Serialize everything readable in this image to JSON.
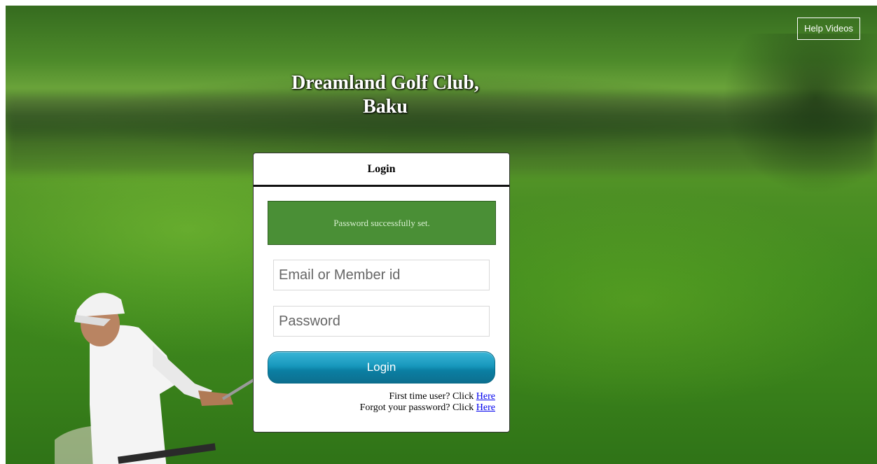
{
  "header": {
    "club_name_line1": "Dreamland Golf Club,",
    "club_name_line2": "Baku",
    "help_label": "Help Videos"
  },
  "login": {
    "title": "Login",
    "alert_message": "Password successfully set.",
    "email_placeholder": "Email or Member id",
    "email_value": "",
    "password_placeholder": "Password",
    "password_value": "",
    "button_label": "Login",
    "first_time_text": "First time user? Click ",
    "first_time_link": "Here",
    "forgot_text": "Forgot your password? Click ",
    "forgot_link": "Here"
  },
  "colors": {
    "alert_bg": "#4a8f36",
    "button_bg": "#1898bd",
    "link": "#0000ee"
  }
}
